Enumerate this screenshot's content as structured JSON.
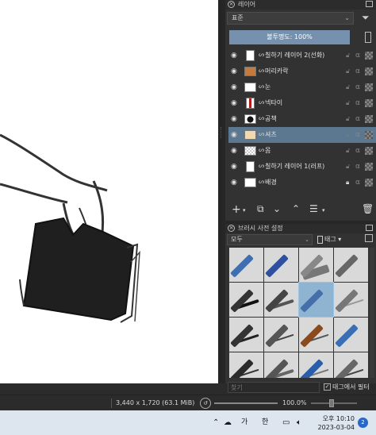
{
  "layers_docker": {
    "title": "레이어",
    "blend_mode": "표준",
    "opacity_label": "불투명도:  100%",
    "layers": [
      {
        "name": "칠하기 레이어 2(선화)",
        "selected": false,
        "locked": false
      },
      {
        "name": "머리카락",
        "selected": false,
        "locked": false
      },
      {
        "name": "눈",
        "selected": false,
        "locked": false
      },
      {
        "name": "넥타이",
        "selected": false,
        "locked": false
      },
      {
        "name": "공책",
        "selected": false,
        "locked": false
      },
      {
        "name": "셔츠",
        "selected": true,
        "locked": false
      },
      {
        "name": "몸",
        "selected": false,
        "locked": false
      },
      {
        "name": "칠하기 레이어 1(러프)",
        "selected": false,
        "locked": false
      },
      {
        "name": "배경",
        "selected": false,
        "locked": true
      }
    ]
  },
  "brush_docker": {
    "title": "브러시 사전 설정",
    "tag_select": "모두",
    "tag_button": "태그",
    "search_placeholder": "찾기",
    "tag_filter_label": "태그에서 필터",
    "tag_filter_checked": true
  },
  "statusbar": {
    "dimensions": "3,440 x 1,720 (63.1 MiB)",
    "zoom": "100.0%"
  },
  "taskbar": {
    "ime_label": "가",
    "lang_label": "한",
    "time": "오후 10:10",
    "date": "2023-03-04",
    "notification_count": "2"
  },
  "colors": {
    "selection": "#5c7891",
    "opacity_bar": "#7591ad",
    "panel_bg": "#323232",
    "taskbar_bg": "#dde5ef"
  }
}
